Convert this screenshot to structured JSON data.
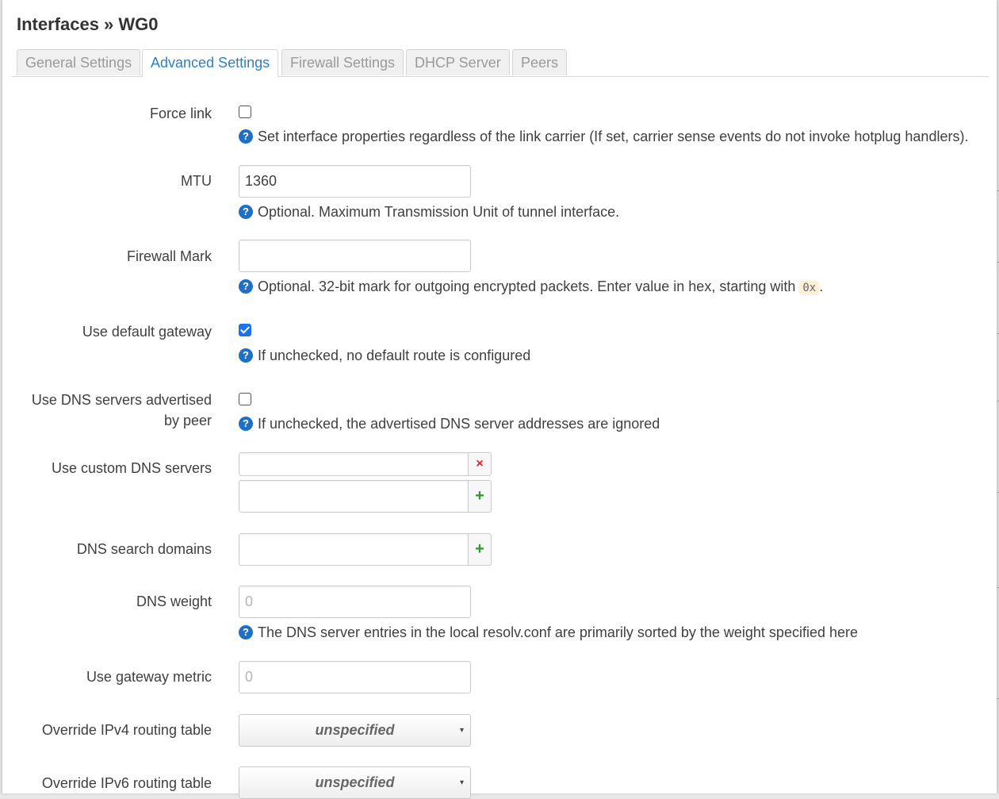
{
  "title": "Interfaces » WG0",
  "tabs": [
    {
      "label": "General Settings",
      "active": false
    },
    {
      "label": "Advanced Settings",
      "active": true
    },
    {
      "label": "Firewall Settings",
      "active": false
    },
    {
      "label": "DHCP Server",
      "active": false
    },
    {
      "label": "Peers",
      "active": false
    }
  ],
  "fields": {
    "force_link": {
      "label": "Force link",
      "checked": false,
      "help": "Set interface properties regardless of the link carrier (If set, carrier sense events do not invoke hotplug handlers)."
    },
    "mtu": {
      "label": "MTU",
      "value": "1360",
      "help": "Optional. Maximum Transmission Unit of tunnel interface."
    },
    "firewall_mark": {
      "label": "Firewall Mark",
      "value": "",
      "help_prefix": "Optional. 32-bit mark for outgoing encrypted packets. Enter value in hex, starting with",
      "help_code": "0x",
      "help_suffix": "."
    },
    "default_gateway": {
      "label": "Use default gateway",
      "checked": true,
      "help": "If unchecked, no default route is configured"
    },
    "peer_dns": {
      "label_line1": "Use DNS servers advertised",
      "label_line2": "by peer",
      "checked": false,
      "help": "If unchecked, the advertised DNS server addresses are ignored"
    },
    "custom_dns": {
      "label": "Use custom DNS servers",
      "remove_symbol": "×",
      "add_symbol": "+"
    },
    "dns_search": {
      "label": "DNS search domains",
      "add_symbol": "+"
    },
    "dns_weight": {
      "label": "DNS weight",
      "placeholder": "0",
      "help": "The DNS server entries in the local resolv.conf are primarily sorted by the weight specified here"
    },
    "gateway_metric": {
      "label": "Use gateway metric",
      "placeholder": "0"
    },
    "ipv4_table": {
      "label": "Override IPv4 routing table",
      "value": "unspecified"
    },
    "ipv6_table": {
      "label": "Override IPv6 routing table",
      "value": "unspecified"
    }
  },
  "help_icon_glyph": "?",
  "caret_glyph": "▾",
  "colors": {
    "accent": "#2d7fc7",
    "help_icon": "#1f6fc5",
    "checkbox_checked": "#1a73e8",
    "remove": "#dd2222",
    "add": "#2a9a2a"
  }
}
